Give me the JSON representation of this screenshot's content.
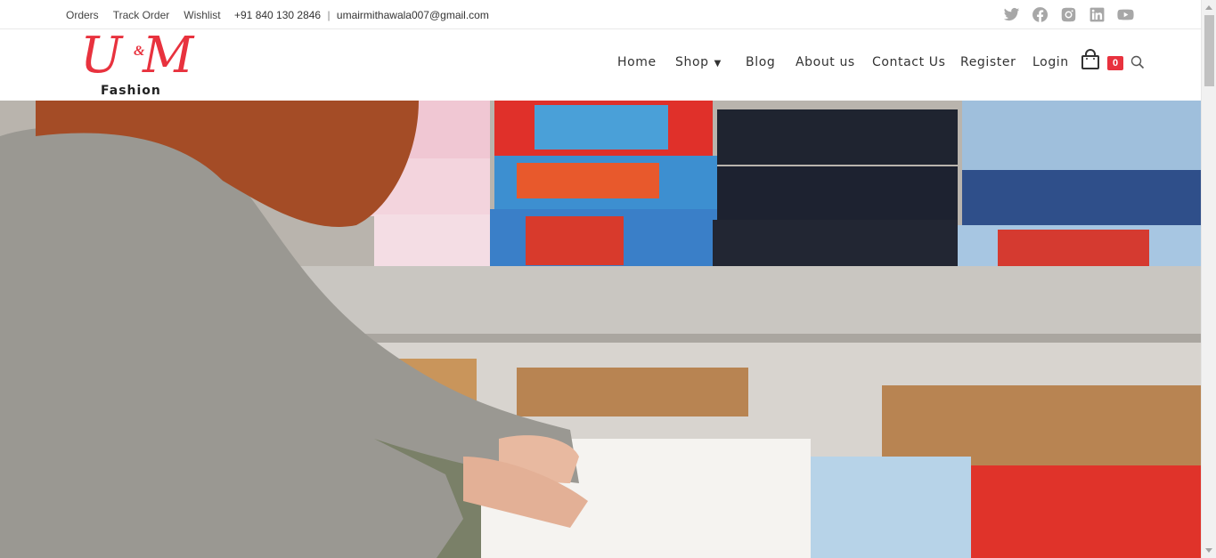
{
  "topbar": {
    "links": [
      "Orders",
      "Track Order",
      "Wishlist"
    ],
    "phone": "+91 840 130 2846",
    "separator": "|",
    "email": "umairmithawala007@gmail.com",
    "social_icons": [
      "twitter-icon",
      "facebook-icon",
      "instagram-icon",
      "linkedin-icon",
      "youtube-icon"
    ]
  },
  "logo": {
    "main": "U M",
    "amp": "&",
    "sub": "Fashion"
  },
  "nav": {
    "items": [
      "Home",
      "Shop",
      "Blog",
      "About us",
      "Contact Us",
      "Register",
      "Login"
    ],
    "cart_count": "0"
  },
  "hero": {
    "description_icon": "clothing-store-hero-image"
  },
  "colors": {
    "accent": "#e8323e",
    "icon_gray": "#a7a7a7",
    "text": "#333333"
  }
}
